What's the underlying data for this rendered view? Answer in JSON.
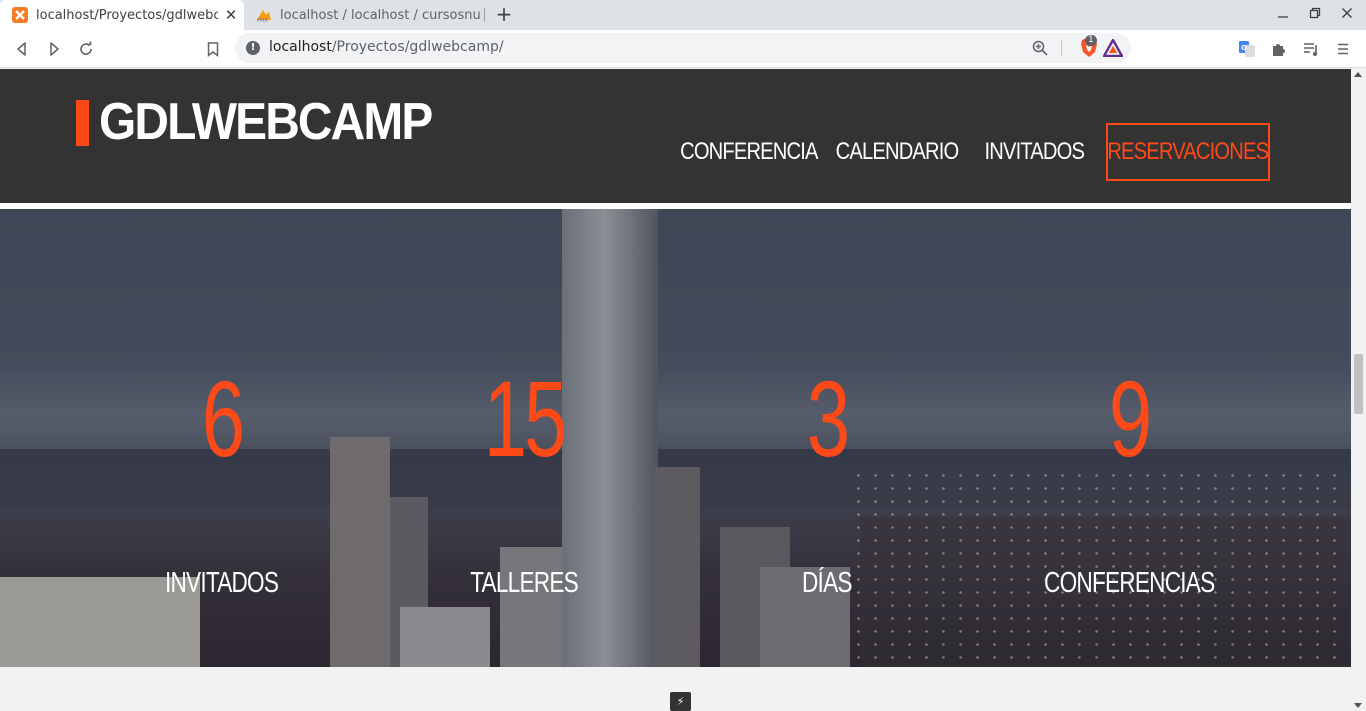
{
  "browser": {
    "tabs": [
      {
        "title": "localhost/Proyectos/gdlwebc",
        "active": true,
        "icon": "xampp-icon"
      },
      {
        "title": "localhost / localhost / cursosnu",
        "active": false,
        "icon": "phpmyadmin-icon"
      }
    ],
    "close_glyph": "✕",
    "new_tab_glyph": "+",
    "url_host": "localhost",
    "url_path": "/Proyectos/gdlwebcamp/",
    "brave_shield_count": "1",
    "accent_colors": {
      "brave": "#fb542b",
      "bat": "#9e1f63"
    }
  },
  "site": {
    "logo": "GDLWEBCAMP",
    "brand_color": "#fe4918",
    "nav": {
      "conferencia": "CONFERENCIA",
      "calendario": "CALENDARIO",
      "invitados": "INVITADOS",
      "reservaciones": "RESERVACIONES"
    },
    "stats": [
      {
        "number": "6",
        "label": "INVITADOS"
      },
      {
        "number": "15",
        "label": "TALLERES"
      },
      {
        "number": "3",
        "label": "DÍAS"
      },
      {
        "number": "9",
        "label": "CONFERENCIAS"
      }
    ]
  }
}
